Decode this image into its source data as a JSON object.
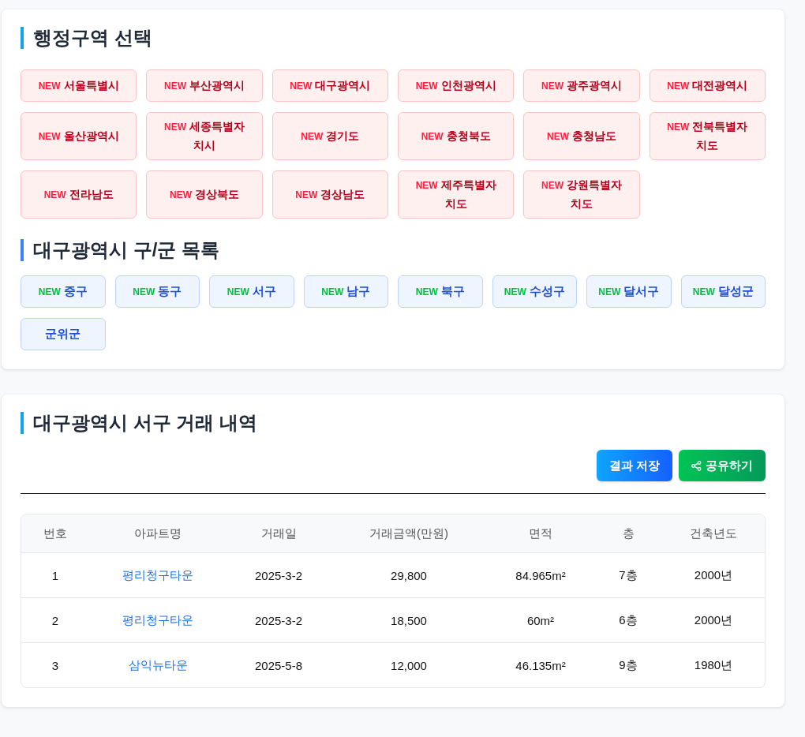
{
  "region_section": {
    "title": "행정구역 선택",
    "regions": [
      {
        "badge": "NEW",
        "name": "서울특별시"
      },
      {
        "badge": "NEW",
        "name": "부산광역시"
      },
      {
        "badge": "NEW",
        "name": "대구광역시"
      },
      {
        "badge": "NEW",
        "name": "인천광역시"
      },
      {
        "badge": "NEW",
        "name": "광주광역시"
      },
      {
        "badge": "NEW",
        "name": "대전광역시"
      },
      {
        "badge": "NEW",
        "name": "울산광역시"
      },
      {
        "badge": "NEW",
        "name": "세종특별자치시"
      },
      {
        "badge": "NEW",
        "name": "경기도"
      },
      {
        "badge": "NEW",
        "name": "충청북도"
      },
      {
        "badge": "NEW",
        "name": "충청남도"
      },
      {
        "badge": "NEW",
        "name": "전북특별자치도"
      },
      {
        "badge": "NEW",
        "name": "전라남도"
      },
      {
        "badge": "NEW",
        "name": "경상북도"
      },
      {
        "badge": "NEW",
        "name": "경상남도"
      },
      {
        "badge": "NEW",
        "name": "제주특별자치도"
      },
      {
        "badge": "NEW",
        "name": "강원특별자치도"
      }
    ]
  },
  "district_section": {
    "title": "대구광역시 구/군 목록",
    "districts": [
      {
        "badge": "NEW",
        "name": "중구"
      },
      {
        "badge": "NEW",
        "name": "동구"
      },
      {
        "badge": "NEW",
        "name": "서구"
      },
      {
        "badge": "NEW",
        "name": "남구"
      },
      {
        "badge": "NEW",
        "name": "북구"
      },
      {
        "badge": "NEW",
        "name": "수성구"
      },
      {
        "badge": "NEW",
        "name": "달서구"
      },
      {
        "badge": "NEW",
        "name": "달성군"
      },
      {
        "name": "군위군"
      }
    ]
  },
  "transactions": {
    "title": "대구광역시 서구 거래 내역",
    "buttons": [
      {
        "label": "결과 저장",
        "kind": "save"
      },
      {
        "label": "공유하기",
        "kind": "share"
      }
    ],
    "table": {
      "columns": [
        "번호",
        "아파트명",
        "거래일",
        "거래금액(만원)",
        "면적",
        "층",
        "건축년도"
      ],
      "rows": [
        [
          "1",
          "평리청구타운",
          "2025-3-2",
          "29,800",
          "84.965m²",
          "7층",
          "2000년"
        ],
        [
          "2",
          "평리청구타운",
          "2025-3-2",
          "18,500",
          "60m²",
          "6층",
          "2000년"
        ],
        [
          "3",
          "삼익뉴타운",
          "2025-5-8",
          "12,000",
          "46.135m²",
          "9층",
          "1980년"
        ]
      ]
    }
  }
}
